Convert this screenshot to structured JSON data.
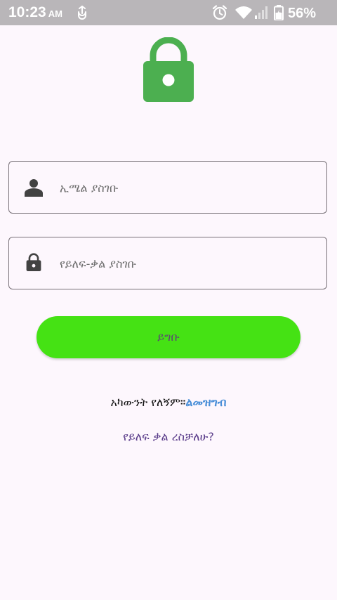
{
  "status_bar": {
    "time": "10:23",
    "ampm": "AM",
    "battery_percent": "56%",
    "icons": [
      "usb-icon",
      "alarm-icon",
      "wifi-icon",
      "signal-icon",
      "battery-icon"
    ]
  },
  "logo": {
    "icon": "lock-icon",
    "color": "#4caf50"
  },
  "email_field": {
    "icon": "person-icon",
    "placeholder": "ኢሜል ያስገቡ",
    "value": ""
  },
  "password_field": {
    "icon": "lock-icon",
    "placeholder": "የይለፍ-ቃል ያስገቡ",
    "value": ""
  },
  "login_button": {
    "label": "ይግቡ",
    "color": "#45e214"
  },
  "signup": {
    "prompt": "አካውንት የለኝም።",
    "link": "ልመዝግብ",
    "link_color": "#4a8fd8"
  },
  "forgot_password": {
    "label": "የይለፍ ቃል ረስቻለሁ?",
    "color": "#5a3c8a"
  },
  "colors": {
    "background": "#fdf7fd",
    "status_bar": "#b9b6b9"
  }
}
